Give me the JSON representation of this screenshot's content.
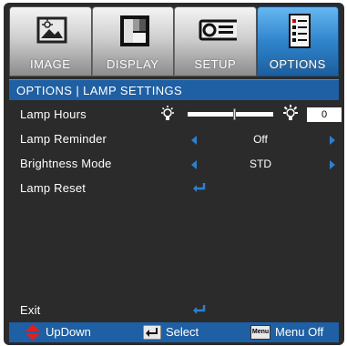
{
  "tabs": [
    {
      "label": "IMAGE",
      "icon": "picture-frame-icon",
      "active": false
    },
    {
      "label": "DISPLAY",
      "icon": "display-pattern-icon",
      "active": false
    },
    {
      "label": "SETUP",
      "icon": "projector-icon",
      "active": false
    },
    {
      "label": "OPTIONS",
      "icon": "checklist-icon",
      "active": true
    }
  ],
  "title": "OPTIONS | LAMP SETTINGS",
  "rows": {
    "lamp_hours": {
      "label": "Lamp Hours",
      "value": "0",
      "slider_level": 0.55
    },
    "lamp_reminder": {
      "label": "Lamp Reminder",
      "value": "Off"
    },
    "brightness_mode": {
      "label": "Brightness Mode",
      "value": "STD"
    },
    "lamp_reset": {
      "label": "Lamp Reset"
    },
    "exit": {
      "label": "Exit"
    }
  },
  "footer": {
    "updown_label": "UpDown",
    "select_label": "Select",
    "menu_key": "Menu",
    "menu_off_label": "Menu Off"
  },
  "colors": {
    "accent_blue": "#1f5fa3",
    "arrow_blue": "#2e7fd0",
    "background": "#2b2b2b"
  }
}
